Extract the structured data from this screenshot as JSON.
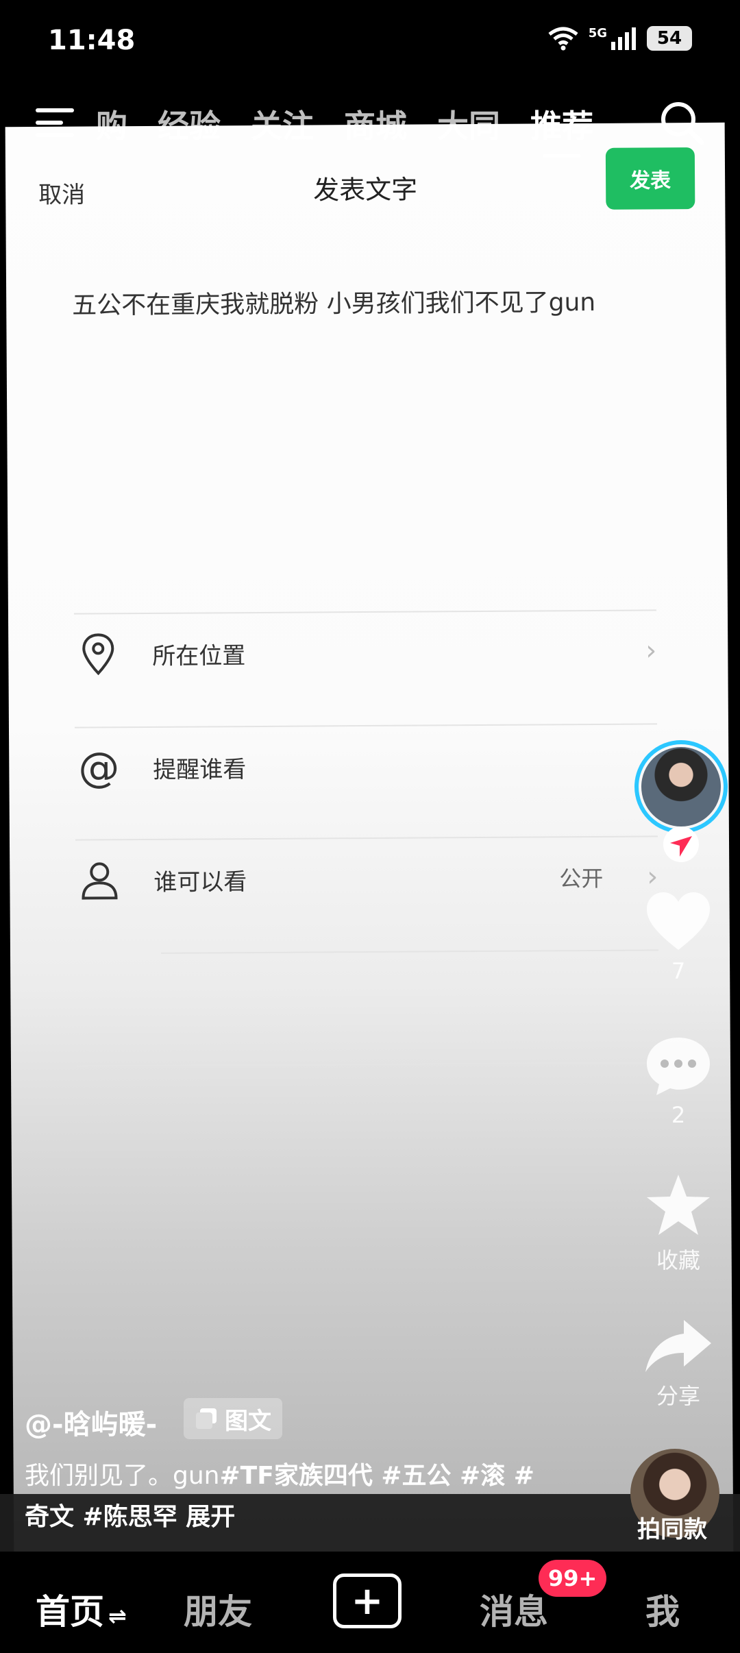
{
  "status_bar": {
    "time": "11:48",
    "network": "5G",
    "battery": "54"
  },
  "top_tabs": {
    "items": [
      "购",
      "经验",
      "关注",
      "商城",
      "大同",
      "推荐"
    ],
    "active": "推荐"
  },
  "post_card": {
    "cancel": "取消",
    "title": "发表文字",
    "publish": "发表",
    "body_text": "五公不在重庆我就脱粉 小男孩们我们不见了gun",
    "options": [
      {
        "label": "所在位置",
        "value": ""
      },
      {
        "label": "提醒谁看",
        "value": ""
      },
      {
        "label": "谁可以看",
        "value": "公开"
      }
    ]
  },
  "actions": {
    "likes": "7",
    "comments": "2",
    "collect": "收藏",
    "share": "分享"
  },
  "caption": {
    "author": "@-晗屿暖-",
    "badge": "图文",
    "line1_plain": "我们别见了。gun",
    "line1_tags": "#TF家族四代 #五公 #滚 #",
    "line2": "奇文 #陈思罕  展开",
    "same_style": "拍同款"
  },
  "bottom_nav": {
    "home": "首页",
    "friends": "朋友",
    "plus": "+",
    "messages": "消息",
    "messages_badge": "99+",
    "me": "我"
  },
  "colors": {
    "publish_green": "#1fbe62",
    "badge_red": "#fe2c55",
    "avatar_ring": "#2cc7ff"
  }
}
